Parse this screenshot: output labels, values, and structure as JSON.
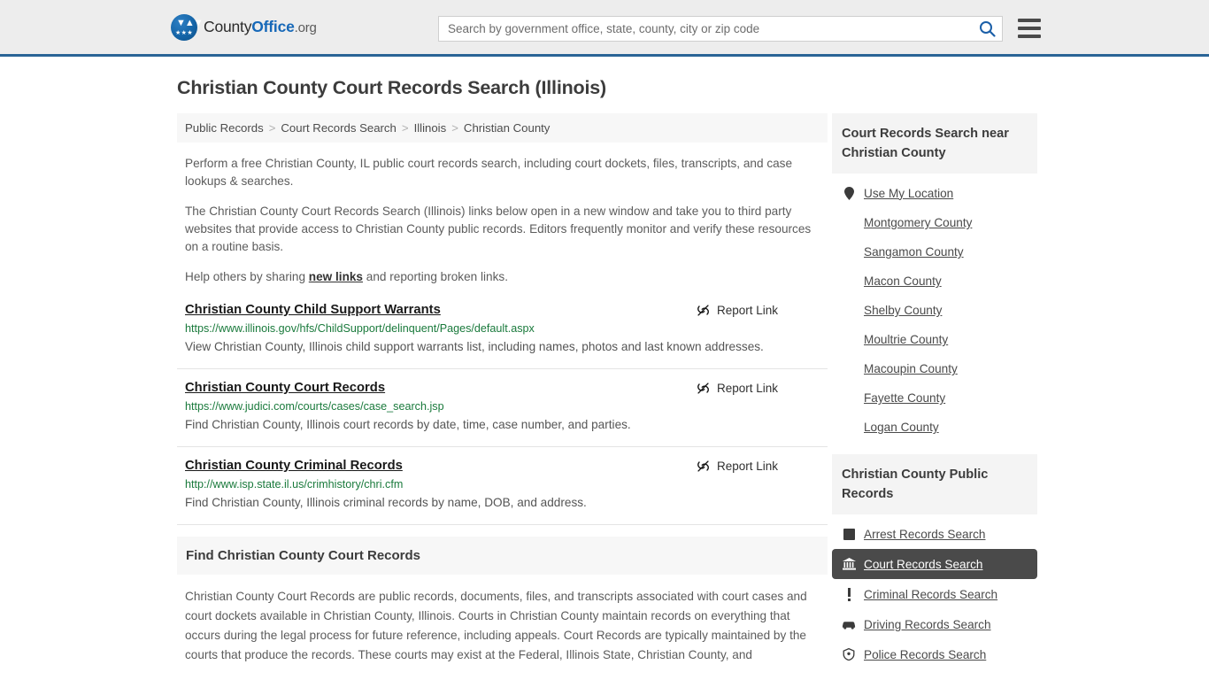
{
  "header": {
    "brand": {
      "part1": "County",
      "part2": "Office",
      "part3": ".org"
    },
    "search": {
      "placeholder": "Search by government office, state, county, city or zip code",
      "value": ""
    },
    "menu_label": "Menu"
  },
  "page": {
    "title": "Christian County Court Records Search (Illinois)"
  },
  "breadcrumb": {
    "items": [
      {
        "label": "Public Records"
      },
      {
        "label": "Court Records Search"
      },
      {
        "label": "Illinois"
      },
      {
        "label": "Christian County"
      }
    ],
    "separator": ">"
  },
  "intro": {
    "p1": "Perform a free Christian County, IL public court records search, including court dockets, files, transcripts, and case lookups & searches.",
    "p2": "The Christian County Court Records Search (Illinois) links below open in a new window and take you to third party websites that provide access to Christian County public records. Editors frequently monitor and verify these resources on a routine basis.",
    "p3_before": "Help others by sharing ",
    "p3_link": "new links",
    "p3_after": " and reporting broken links."
  },
  "results": {
    "report_label": "Report Link",
    "items": [
      {
        "title": "Christian County Child Support Warrants",
        "url": "https://www.illinois.gov/hfs/ChildSupport/delinquent/Pages/default.aspx",
        "description": "View Christian County, Illinois child support warrants list, including names, photos and last known addresses."
      },
      {
        "title": "Christian County Court Records",
        "url": "https://www.judici.com/courts/cases/case_search.jsp",
        "description": "Find Christian County, Illinois court records by date, time, case number, and parties."
      },
      {
        "title": "Christian County Criminal Records",
        "url": "http://www.isp.state.il.us/crimhistory/chri.cfm",
        "description": "Find Christian County, Illinois criminal records by name, DOB, and address."
      }
    ]
  },
  "find_section": {
    "heading": "Find Christian County Court Records",
    "body": "Christian County Court Records are public records, documents, files, and transcripts associated with court cases and court dockets available in Christian County, Illinois. Courts in Christian County maintain records on everything that occurs during the legal process for future reference, including appeals. Court Records are typically maintained by the courts that produce the records. These courts may exist at the Federal, Illinois State, Christian County, and"
  },
  "sidebar": {
    "nearby": {
      "heading": "Court Records Search near Christian County",
      "items": [
        {
          "label": "Use My Location",
          "icon": "location-pin-icon"
        },
        {
          "label": "Montgomery County",
          "icon": ""
        },
        {
          "label": "Sangamon County",
          "icon": ""
        },
        {
          "label": "Macon County",
          "icon": ""
        },
        {
          "label": "Shelby County",
          "icon": ""
        },
        {
          "label": "Moultrie County",
          "icon": ""
        },
        {
          "label": "Macoupin County",
          "icon": ""
        },
        {
          "label": "Fayette County",
          "icon": ""
        },
        {
          "label": "Logan County",
          "icon": ""
        }
      ]
    },
    "public_records": {
      "heading": "Christian County Public Records",
      "items": [
        {
          "label": "Arrest Records Search",
          "icon": "handcuffs-icon",
          "active": false
        },
        {
          "label": "Court Records Search",
          "icon": "courthouse-icon",
          "active": true
        },
        {
          "label": "Criminal Records Search",
          "icon": "exclamation-icon",
          "active": false
        },
        {
          "label": "Driving Records Search",
          "icon": "car-icon",
          "active": false
        },
        {
          "label": "Police Records Search",
          "icon": "police-badge-icon",
          "active": false
        }
      ]
    }
  },
  "colors": {
    "header_bg": "#ededed",
    "header_border": "#2a6496",
    "brand_blue": "#1668b8",
    "url_green": "#1a7a3c",
    "active_bg": "#4a4a4a",
    "panel_bg": "#f4f4f4"
  }
}
